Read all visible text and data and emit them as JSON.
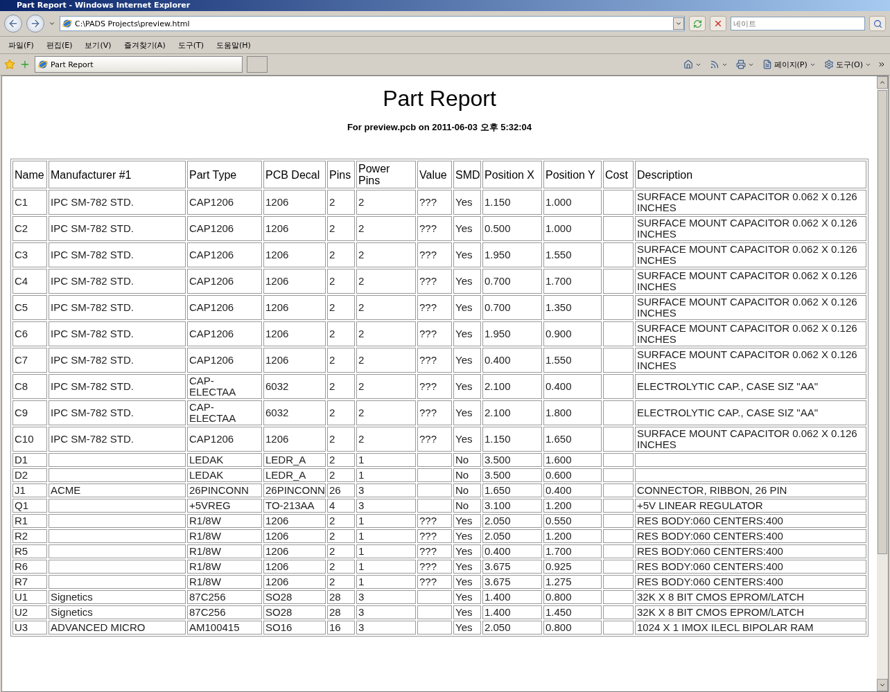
{
  "window": {
    "title": "Part Report - Windows Internet Explorer"
  },
  "address_bar": {
    "url": "C:\\PADS Projects\\preview.html"
  },
  "search": {
    "placeholder": "네이트"
  },
  "menu": [
    "파일(F)",
    "편집(E)",
    "보기(V)",
    "즐겨찾기(A)",
    "도구(T)",
    "도움말(H)"
  ],
  "tabs": [
    {
      "label": "Part Report",
      "selected": true
    }
  ],
  "command_bar": [
    {
      "kind": "home"
    },
    {
      "kind": "feeds"
    },
    {
      "kind": "print"
    },
    {
      "kind": "page",
      "label": "페이지(P)"
    },
    {
      "kind": "tools",
      "label": "도구(O)"
    }
  ],
  "page": {
    "title": "Part Report",
    "subtitle": "For preview.pcb on 2011-06-03 오후 5:32:04"
  },
  "table": {
    "columns": [
      "Name",
      "Manufacturer #1",
      "Part Type",
      "PCB Decal",
      "Pins",
      "Power Pins",
      "Value",
      "SMD",
      "Position X",
      "Position Y",
      "Cost",
      "Description"
    ],
    "rows": [
      {
        "cells": [
          "C1",
          "IPC SM-782 STD.",
          "CAP1206",
          "1206",
          "2",
          "2",
          "???",
          "Yes",
          "1.150",
          "1.000",
          null,
          "SURFACE MOUNT CAPACITOR 0.062 X 0.126 INCHES"
        ]
      },
      {
        "cells": [
          "C2",
          "IPC SM-782 STD.",
          "CAP1206",
          "1206",
          "2",
          "2",
          "???",
          "Yes",
          "0.500",
          "1.000",
          null,
          "SURFACE MOUNT CAPACITOR 0.062 X 0.126 INCHES"
        ]
      },
      {
        "cells": [
          "C3",
          "IPC SM-782 STD.",
          "CAP1206",
          "1206",
          "2",
          "2",
          "???",
          "Yes",
          "1.950",
          "1.550",
          null,
          "SURFACE MOUNT CAPACITOR 0.062 X 0.126 INCHES"
        ]
      },
      {
        "cells": [
          "C4",
          "IPC SM-782 STD.",
          "CAP1206",
          "1206",
          "2",
          "2",
          "???",
          "Yes",
          "0.700",
          "1.700",
          null,
          "SURFACE MOUNT CAPACITOR 0.062 X 0.126 INCHES"
        ]
      },
      {
        "cells": [
          "C5",
          "IPC SM-782 STD.",
          "CAP1206",
          "1206",
          "2",
          "2",
          "???",
          "Yes",
          "0.700",
          "1.350",
          null,
          "SURFACE MOUNT CAPACITOR 0.062 X 0.126 INCHES"
        ]
      },
      {
        "cells": [
          "C6",
          "IPC SM-782 STD.",
          "CAP1206",
          "1206",
          "2",
          "2",
          "???",
          "Yes",
          "1.950",
          "0.900",
          null,
          "SURFACE MOUNT CAPACITOR 0.062 X 0.126 INCHES"
        ]
      },
      {
        "cells": [
          "C7",
          "IPC SM-782 STD.",
          "CAP1206",
          "1206",
          "2",
          "2",
          "???",
          "Yes",
          "0.400",
          "1.550",
          null,
          "SURFACE MOUNT CAPACITOR 0.062 X 0.126 INCHES"
        ]
      },
      {
        "cells": [
          "C8",
          "IPC SM-782 STD.",
          "CAP-ELECTAA",
          "6032",
          "2",
          "2",
          "???",
          "Yes",
          "2.100",
          "0.400",
          null,
          "ELECTROLYTIC CAP., CASE SIZ \"AA\""
        ]
      },
      {
        "cells": [
          "C9",
          "IPC SM-782 STD.",
          "CAP-ELECTAA",
          "6032",
          "2",
          "2",
          "???",
          "Yes",
          "2.100",
          "1.800",
          null,
          "ELECTROLYTIC CAP., CASE SIZ \"AA\""
        ]
      },
      {
        "cells": [
          "C10",
          "IPC SM-782 STD.",
          "CAP1206",
          "1206",
          "2",
          "2",
          "???",
          "Yes",
          "1.150",
          "1.650",
          null,
          "SURFACE MOUNT CAPACITOR 0.062 X 0.126 INCHES"
        ]
      },
      {
        "cells": [
          "D1",
          null,
          "LEDAK",
          "LEDR_A",
          "2",
          "1",
          null,
          "No",
          "3.500",
          "1.600",
          null,
          null
        ]
      },
      {
        "cells": [
          "D2",
          null,
          "LEDAK",
          "LEDR_A",
          "2",
          "1",
          null,
          "No",
          "3.500",
          "0.600",
          null,
          null
        ]
      },
      {
        "cells": [
          "J1",
          "ACME",
          "26PINCONN",
          "26PINCONN",
          "26",
          "3",
          null,
          "No",
          "1.650",
          "0.400",
          null,
          "CONNECTOR, RIBBON, 26 PIN"
        ]
      },
      {
        "cells": [
          "Q1",
          null,
          "+5VREG",
          "TO-213AA",
          "4",
          "3",
          null,
          "No",
          "3.100",
          "1.200",
          null,
          "+5V LINEAR REGULATOR"
        ]
      },
      {
        "cells": [
          "R1",
          null,
          "R1/8W",
          "1206",
          "2",
          "1",
          "???",
          "Yes",
          "2.050",
          "0.550",
          null,
          "RES BODY:060 CENTERS:400"
        ]
      },
      {
        "cells": [
          "R2",
          null,
          "R1/8W",
          "1206",
          "2",
          "1",
          "???",
          "Yes",
          "2.050",
          "1.200",
          null,
          "RES BODY:060 CENTERS:400"
        ]
      },
      {
        "cells": [
          "R5",
          null,
          "R1/8W",
          "1206",
          "2",
          "1",
          "???",
          "Yes",
          "0.400",
          "1.700",
          null,
          "RES BODY:060 CENTERS:400"
        ]
      },
      {
        "cells": [
          "R6",
          null,
          "R1/8W",
          "1206",
          "2",
          "1",
          "???",
          "Yes",
          "3.675",
          "0.925",
          null,
          "RES BODY:060 CENTERS:400"
        ]
      },
      {
        "cells": [
          "R7",
          null,
          "R1/8W",
          "1206",
          "2",
          "1",
          "???",
          "Yes",
          "3.675",
          "1.275",
          null,
          "RES BODY:060 CENTERS:400"
        ]
      },
      {
        "cells": [
          "U1",
          "Signetics",
          "87C256",
          "SO28",
          "28",
          "3",
          null,
          "Yes",
          "1.400",
          "0.800",
          null,
          "32K X 8 BIT CMOS EPROM/LATCH"
        ]
      },
      {
        "cells": [
          "U2",
          "Signetics",
          "87C256",
          "SO28",
          "28",
          "3",
          null,
          "Yes",
          "1.400",
          "1.450",
          null,
          "32K X 8 BIT CMOS EPROM/LATCH"
        ]
      },
      {
        "cells": [
          "U3",
          "ADVANCED MICRO",
          "AM100415",
          "SO16",
          "16",
          "3",
          null,
          "Yes",
          "2.050",
          "0.800",
          null,
          "1024 X 1 IMOX ILECL BIPOLAR RAM"
        ]
      }
    ]
  }
}
